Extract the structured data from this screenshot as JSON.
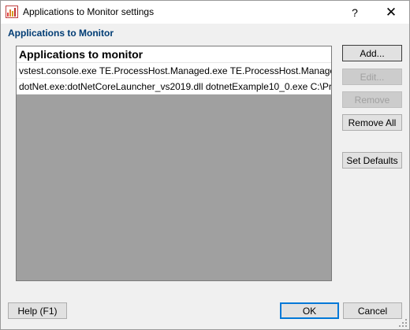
{
  "window": {
    "title": "Applications to Monitor settings",
    "help_glyph": "?",
    "close_glyph": "✕"
  },
  "section_label": "Applications to Monitor",
  "list": {
    "header": "Applications to monitor",
    "rows": [
      "vstest.console.exe TE.ProcessHost.Managed.exe TE.ProcessHost.Manage...",
      "dotNet.exe:dotNetCoreLauncher_vs2019.dll dotnetExample10_0.exe C:\\Pr..."
    ]
  },
  "buttons": {
    "add": "Add...",
    "edit": "Edit...",
    "remove": "Remove",
    "remove_all": "Remove All",
    "set_defaults": "Set Defaults",
    "help": "Help (F1)",
    "ok": "OK",
    "cancel": "Cancel"
  },
  "icons": {
    "app": "bar-chart-icon",
    "close": "close-icon",
    "help": "help-icon",
    "grip": "resize-grip-icon"
  },
  "colors": {
    "section_label": "#003c74",
    "list_background": "#a0a0a0",
    "default_button_border": "#0078d7"
  }
}
